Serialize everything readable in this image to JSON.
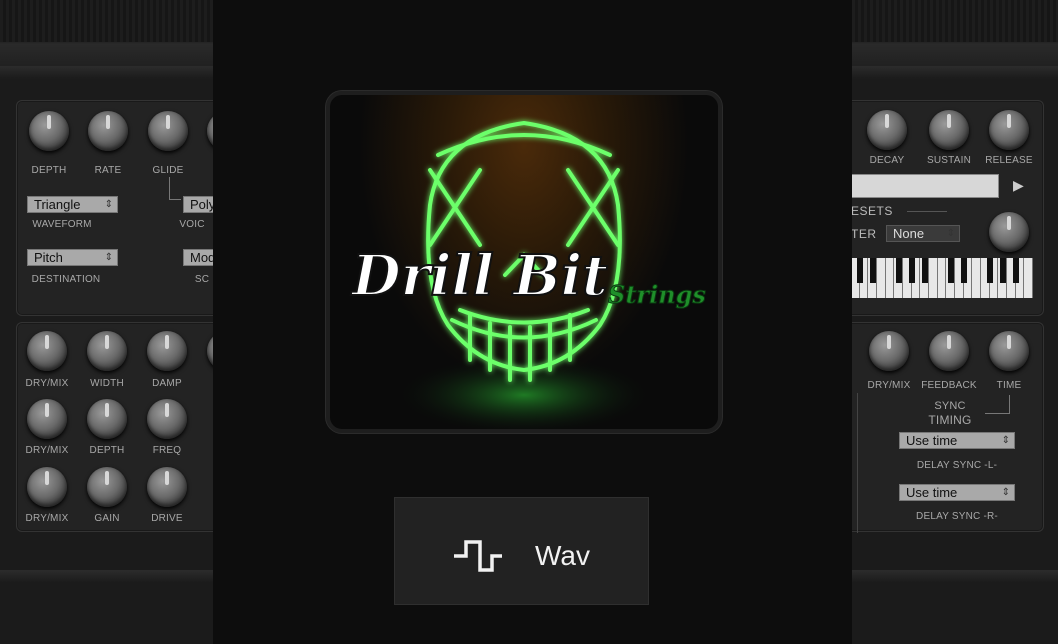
{
  "left": {
    "mod_knobs": [
      "DEPTH",
      "RATE",
      "GLIDE"
    ],
    "waveform": {
      "value": "Triangle",
      "label": "WAVEFORM"
    },
    "voice": {
      "value": "Poly",
      "label": "VOIC"
    },
    "destination": {
      "value": "Pitch",
      "label": "DESTINATION"
    },
    "source": {
      "value": "Mod",
      "label": "SC"
    },
    "fx_rows": [
      [
        "DRY/MIX",
        "WIDTH",
        "DAMP"
      ],
      [
        "DRY/MIX",
        "DEPTH",
        "FREQ"
      ],
      [
        "DRY/MIX",
        "GAIN",
        "DRIVE"
      ]
    ]
  },
  "right": {
    "env_knobs": [
      "DECAY",
      "SUSTAIN",
      "RELEASE"
    ],
    "presets_label": "ESETS",
    "filter_label": "TER",
    "filter_value": "None",
    "delay_knobs": [
      "DRY/MIX",
      "FEEDBACK",
      "TIME"
    ],
    "sync_label": "SYNC",
    "timing_label": "TIMING",
    "delay_l": {
      "value": "Use time",
      "label": "DELAY SYNC -L-"
    },
    "delay_r": {
      "value": "Use time",
      "label": "DELAY SYNC -R-"
    }
  },
  "artwork": {
    "title": "Drill Bit",
    "subtitle": "Strings"
  },
  "wav_button": {
    "label": "Wav",
    "icon": "square-wave-icon"
  }
}
